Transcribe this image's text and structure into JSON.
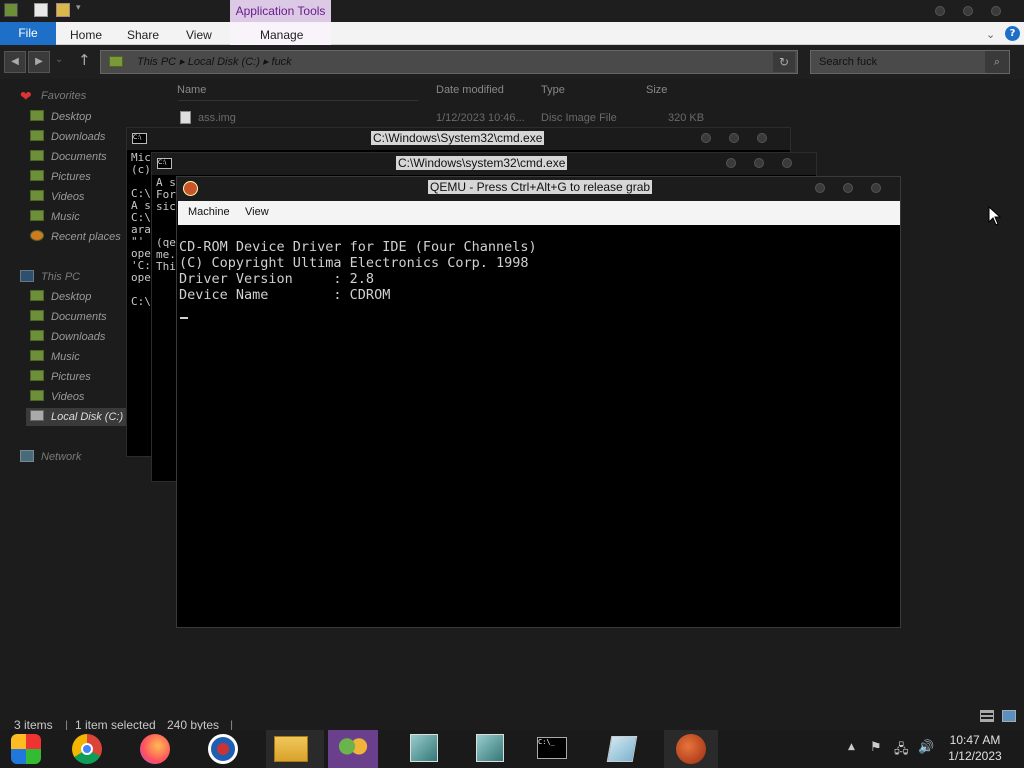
{
  "explorer": {
    "contextual_tab": "Application Tools",
    "tabs": {
      "file": "File",
      "home": "Home",
      "share": "Share",
      "view": "View",
      "manage": "Manage"
    },
    "address": {
      "path": "This PC  ▸  Local Disk (C:)  ▸  fuck"
    },
    "search": {
      "placeholder": "Search fuck"
    },
    "nav": {
      "favorites": "Favorites",
      "fav_items": [
        "Desktop",
        "Downloads",
        "Documents",
        "Pictures",
        "Videos",
        "Music",
        "Recent places"
      ],
      "this_pc": "This PC",
      "pc_items": [
        "Desktop",
        "Documents",
        "Downloads",
        "Music",
        "Pictures",
        "Videos",
        "Local Disk (C:)"
      ],
      "network": "Network"
    },
    "columns": {
      "name": "Name",
      "date": "Date modified",
      "type": "Type",
      "size": "Size"
    },
    "files": [
      {
        "name": "ass.img",
        "date": "1/12/2023 10:46...",
        "type": "Disc Image File",
        "size": "320 KB"
      }
    ],
    "status": {
      "items": "3 items",
      "selected": "1 item selected",
      "bytes": "240 bytes"
    }
  },
  "cmd1": {
    "title": "C:\\Windows\\System32\\cmd.exe",
    "lines": [
      "Mic",
      "(c)",
      "",
      "C:\\",
      "A s",
      "C:\\",
      "ara",
      "\"'",
      "ope",
      "'C:",
      "ope",
      "",
      "C:\\"
    ]
  },
  "cmd2": {
    "title": "C:\\Windows\\system32\\cmd.exe",
    "lines": [
      "A s",
      "For",
      "sic",
      "",
      "",
      "(qe",
      "me.",
      "Thi"
    ]
  },
  "qemu": {
    "title": "QEMU - Press Ctrl+Alt+G to release grab",
    "menu": {
      "machine": "Machine",
      "view": "View"
    },
    "screen": [
      "CD-ROM Device Driver for IDE (Four Channels)",
      "(C) Copyright Ultima Electronics Corp. 1998",
      "Driver Version     : 2.8",
      "Device Name        : CDROM"
    ]
  },
  "taskbar": {
    "clock_time": "10:47 AM",
    "clock_date": "1/12/2023",
    "apps": [
      "windows-media-icon",
      "chrome-icon",
      "firefox-icon",
      "opera-icon",
      "file-explorer-icon",
      "network-users-icon",
      "installer-icon",
      "installer2-icon",
      "cmd-icon",
      "notepad-icon",
      "qemu-icon"
    ]
  },
  "colors": {
    "accent_blue": "#1e6fc8",
    "context_tab": "#dcc9e6",
    "context_text": "#6a1d8a"
  }
}
